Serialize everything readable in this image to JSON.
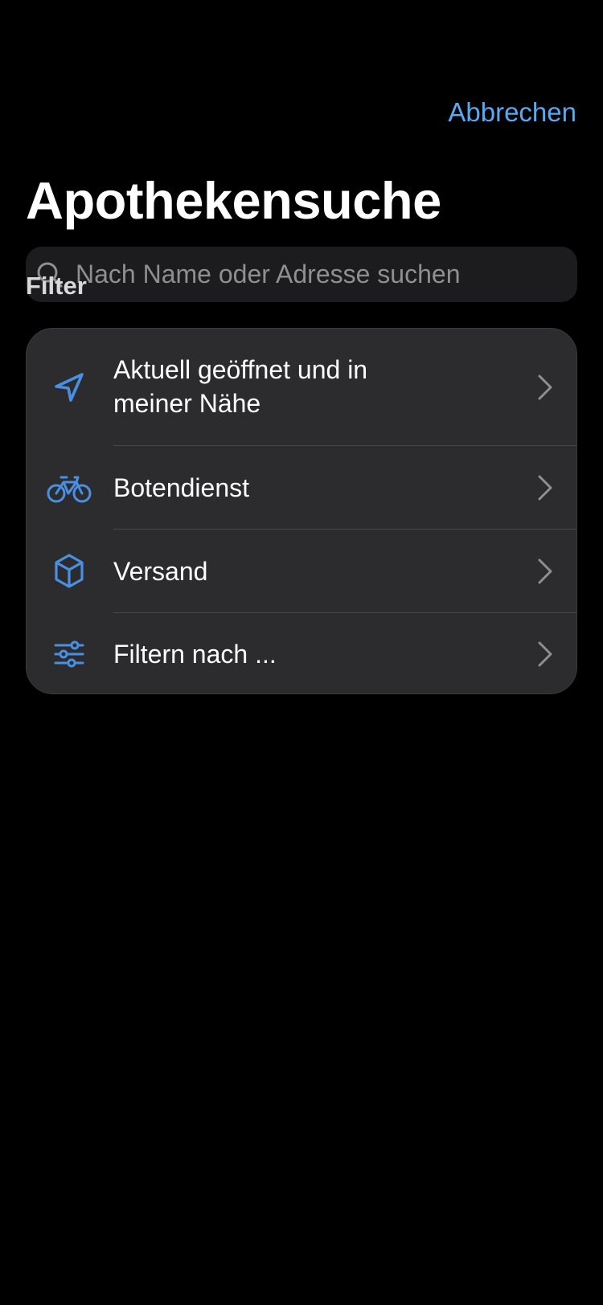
{
  "nav": {
    "cancel_label": "Abbrechen"
  },
  "page": {
    "title": "Apothekensuche"
  },
  "search": {
    "placeholder": "Nach Name oder Adresse suchen",
    "value": "",
    "icon": "search-icon"
  },
  "filter_section": {
    "header": "Filter",
    "items": [
      {
        "label_line1": "Aktuell geöffnet und in",
        "label_line2": "meiner Nähe",
        "icon": "location-arrow-icon"
      },
      {
        "label": "Botendienst",
        "icon": "bicycle-icon"
      },
      {
        "label": "Versand",
        "icon": "package-icon"
      },
      {
        "label": "Filtern nach ...",
        "icon": "sliders-icon"
      }
    ]
  },
  "colors": {
    "accent": "#4a90e2",
    "link": "#5aa8f2",
    "background": "#000000",
    "card": "#2c2c2e",
    "search_field": "#1c1c1e",
    "placeholder": "#8e8e93"
  }
}
